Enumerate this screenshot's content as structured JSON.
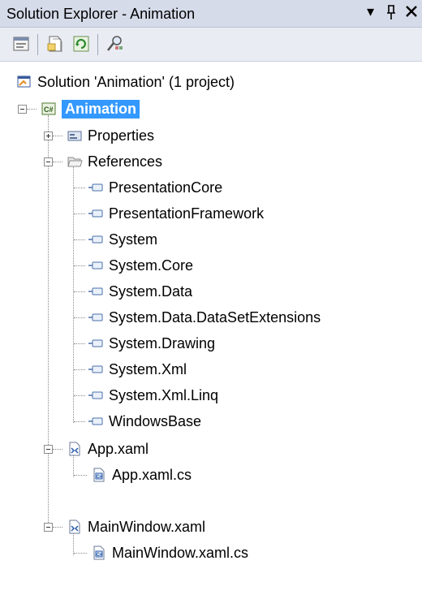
{
  "window": {
    "title": "Solution Explorer - Animation",
    "dropdown_glyph": "▾",
    "pin_glyph": "ᵻ",
    "close_glyph": "✕"
  },
  "toolbar": {
    "items": [
      "properties-icon",
      "show-all-files-icon",
      "refresh-icon",
      "class-view-icon"
    ]
  },
  "tree": {
    "solution": "Solution 'Animation' (1 project)",
    "project": "Animation",
    "properties": "Properties",
    "references": "References",
    "refs": [
      "PresentationCore",
      "PresentationFramework",
      "System",
      "System.Core",
      "System.Data",
      "System.Data.DataSetExtensions",
      "System.Drawing",
      "System.Xml",
      "System.Xml.Linq",
      "WindowsBase"
    ],
    "app_xaml": "App.xaml",
    "app_xaml_cs": "App.xaml.cs",
    "main_xaml": "MainWindow.xaml",
    "main_xaml_cs": "MainWindow.xaml.cs"
  },
  "colors": {
    "selection": "#3399ff",
    "titlebar": "#d6dbe9"
  }
}
